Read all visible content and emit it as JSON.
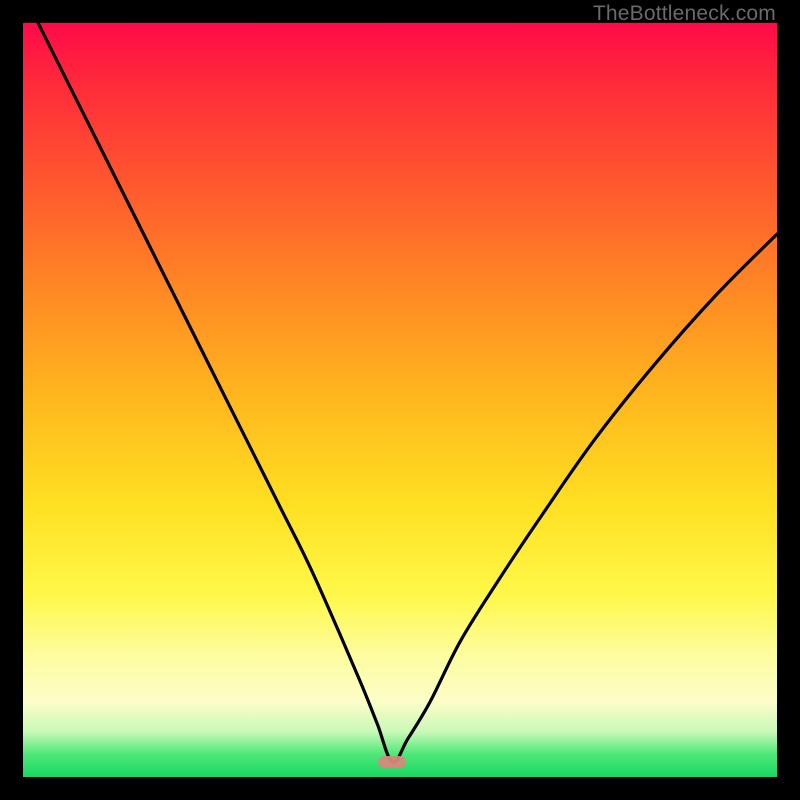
{
  "attribution": "TheBottleneck.com",
  "colors": {
    "frame_border": "#000000",
    "curve_stroke": "#000000",
    "notch_fill": "#d48a7a",
    "gradient_stops": [
      "#ff0a4a",
      "#ff2a3a",
      "#ff5a2e",
      "#ff8a24",
      "#ffb81e",
      "#ffe022",
      "#fff84a",
      "#fdfda0",
      "#fdfdc8",
      "#c8f9b8",
      "#4de878",
      "#18d862"
    ]
  },
  "chart_data": {
    "type": "line",
    "title": "",
    "xlabel": "",
    "ylabel": "",
    "xlim": [
      0,
      100
    ],
    "ylim": [
      0,
      100
    ],
    "grid": false,
    "notch": {
      "x": 49,
      "y": 2
    },
    "series": [
      {
        "name": "bottleneck-curve",
        "x": [
          2,
          6,
          10,
          14,
          18,
          22,
          26,
          30,
          34,
          38,
          42,
          45,
          47,
          49,
          51,
          54,
          58,
          63,
          69,
          76,
          84,
          92,
          100
        ],
        "y": [
          100,
          92,
          84,
          76,
          68,
          60,
          52,
          44,
          36,
          28,
          19,
          12,
          7,
          2,
          5,
          10,
          18,
          26,
          35,
          45,
          55,
          64,
          72
        ]
      }
    ]
  }
}
